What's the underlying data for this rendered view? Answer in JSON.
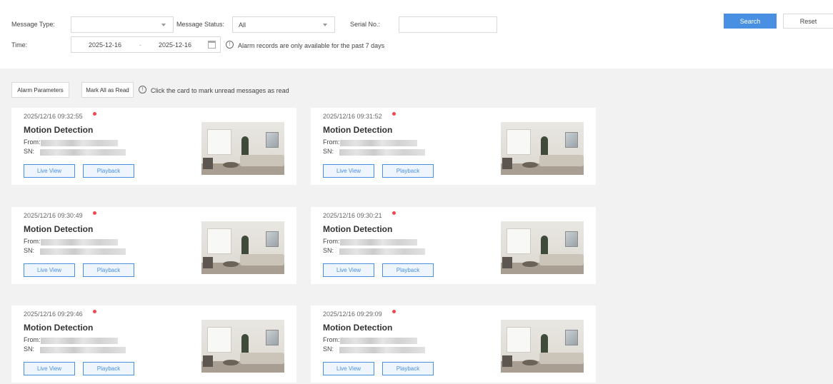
{
  "filters": {
    "message_type_label": "Message Type:",
    "message_type_value": "",
    "message_status_label": "Message Status:",
    "message_status_value": "All",
    "serial_label": "Serial No.:",
    "serial_value": "",
    "time_label": "Time:",
    "date_start": "2025-12-16",
    "date_sep": "-",
    "date_end": "2025-12-16",
    "time_hint": "Alarm records are only available for the past 7 days",
    "search_label": "Search",
    "reset_label": "Reset"
  },
  "actions": {
    "alarm_params_label": "Alarm Parameters",
    "mark_all_label": "Mark All as Read",
    "hint": "Click the card to mark unread messages as read"
  },
  "cards": [
    {
      "timestamp": "2025/12/16 09:32:55",
      "title": "Motion Detection",
      "from_label": "From:",
      "sn_label": "SN:",
      "live_label": "Live View",
      "playback_label": "Playback",
      "unread": true
    },
    {
      "timestamp": "2025/12/16 09:31:52",
      "title": "Motion Detection",
      "from_label": "From:",
      "sn_label": "SN:",
      "live_label": "Live View",
      "playback_label": "Playback",
      "unread": true
    },
    {
      "timestamp": "2025/12/16 09:30:49",
      "title": "Motion Detection",
      "from_label": "From:",
      "sn_label": "SN:",
      "live_label": "Live View",
      "playback_label": "Playback",
      "unread": true
    },
    {
      "timestamp": "2025/12/16 09:30:21",
      "title": "Motion Detection",
      "from_label": "From:",
      "sn_label": "SN:",
      "live_label": "Live View",
      "playback_label": "Playback",
      "unread": true
    },
    {
      "timestamp": "2025/12/16 09:29:46",
      "title": "Motion Detection",
      "from_label": "From:",
      "sn_label": "SN:",
      "live_label": "Live View",
      "playback_label": "Playback",
      "unread": true
    },
    {
      "timestamp": "2025/12/16 09:29:09",
      "title": "Motion Detection",
      "from_label": "From:",
      "sn_label": "SN:",
      "live_label": "Live View",
      "playback_label": "Playback",
      "unread": true
    }
  ],
  "colors": {
    "accent": "#4a90e2",
    "unread_dot": "#f0484d",
    "page_bg": "#f2f2f2"
  },
  "icons": {
    "select_caret": "chevron-down-icon",
    "calendar": "calendar-icon",
    "info": "info-icon"
  }
}
